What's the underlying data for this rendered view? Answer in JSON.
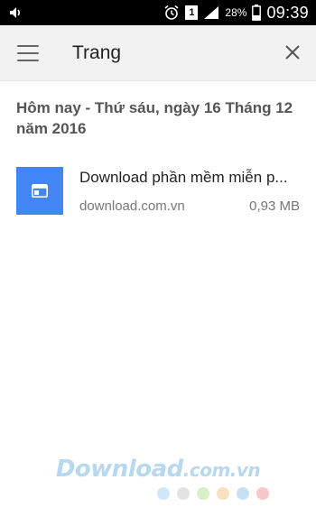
{
  "status_bar": {
    "battery_percent": "28%",
    "time": "09:39",
    "sim_number": "1"
  },
  "toolbar": {
    "title": "Trang"
  },
  "history": {
    "date_header": "Hôm nay - Thứ sáu, ngày 16 Tháng 12 năm 2016",
    "items": [
      {
        "title": "Download phần mềm miễn p...",
        "domain": "download.com.vn",
        "size": "0,93 MB"
      }
    ]
  },
  "watermark": {
    "brand": "Download",
    "suffix": ".com.vn",
    "dot_colors": [
      "#cfe8f7",
      "#e3e3e3",
      "#d8f0c8",
      "#f8e0c0",
      "#c8e0f5",
      "#f8c8c8"
    ]
  },
  "colors": {
    "accent": "#4285f4",
    "toolbar_bg": "#f2f2f2"
  }
}
